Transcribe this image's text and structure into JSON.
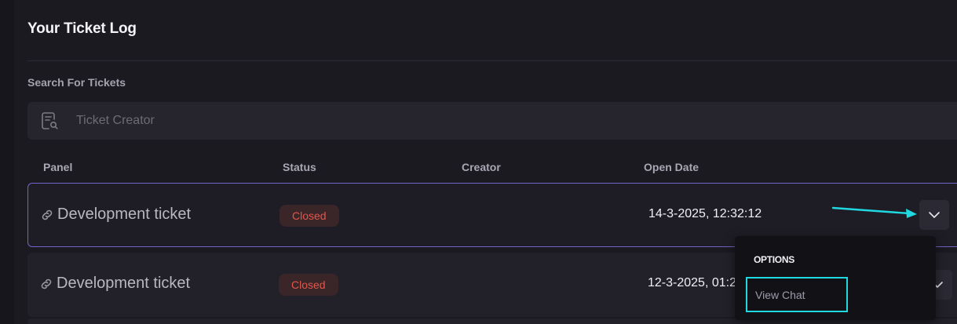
{
  "page": {
    "title": "Your Ticket Log"
  },
  "search": {
    "label": "Search For Tickets",
    "placeholder": "Ticket Creator",
    "value": ""
  },
  "table": {
    "columns": [
      "Panel",
      "Status",
      "Creator",
      "Open Date"
    ],
    "rows": [
      {
        "panel": "Development ticket",
        "status": "Closed",
        "creator": "",
        "open_date": "14-3-2025, 12:32:12"
      },
      {
        "panel": "Development ticket",
        "status": "Closed",
        "creator": "",
        "open_date": "12-3-2025, 01:2"
      }
    ]
  },
  "options_menu": {
    "heading": "OPTIONS",
    "items": [
      "View Chat"
    ]
  },
  "colors": {
    "accent_border": "#6f64c9",
    "highlight": "#1fd8e0",
    "closed_text": "#e2574c",
    "closed_bg": "#3a2528"
  },
  "icons": {
    "search": "ticket-search-icon",
    "link": "link-icon",
    "expand": "chevron-down-icon",
    "arrow": "arrow-icon"
  }
}
